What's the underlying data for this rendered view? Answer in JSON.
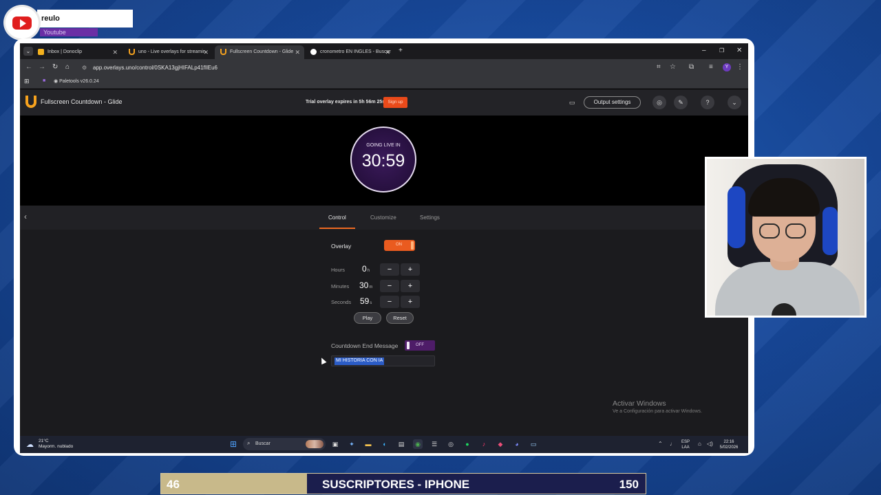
{
  "overlay_badge": {
    "channel_name": "reulo",
    "platform": "Youtube"
  },
  "browser": {
    "tabs": [
      {
        "label": "Inbox | Donoclip",
        "active": false
      },
      {
        "label": "uno - Live overlays for streamin",
        "active": false
      },
      {
        "label": "Fullscreen Countdown - Glide",
        "active": true
      },
      {
        "label": "cronometro EN INGLES - Buscar",
        "active": false
      }
    ],
    "url": "app.overlays.uno/control/0SKA13gjHIFALp41fIlEu6",
    "bookmark": "Paletools v26.0.24"
  },
  "app_header": {
    "title": "Fullscreen Countdown  -  Glide",
    "trial_text": "Trial overlay expires in 5h 56m 25s",
    "signup_label": "Sign up",
    "output_settings_label": "Output settings"
  },
  "preview": {
    "label": "GOING LIVE IN",
    "time": "30:59"
  },
  "control_tabs": [
    "Control",
    "Customize",
    "Settings"
  ],
  "controls": {
    "overlay_label": "Overlay",
    "overlay_state": "ON",
    "hours_label": "Hours",
    "hours_value": "0",
    "hours_unit": "h",
    "minutes_label": "Minutes",
    "minutes_value": "30",
    "minutes_unit": "m",
    "seconds_label": "Seconds",
    "seconds_value": "59",
    "seconds_unit": "s",
    "minus": "−",
    "plus": "+",
    "play_label": "Play",
    "reset_label": "Reset",
    "end_message_label": "Countdown End Message",
    "end_message_state": "OFF",
    "end_message_value": "MI HISTORIA CON IA"
  },
  "watermark": {
    "line1": "Activar Windows",
    "line2": "Ve a Configuración para activar Windows."
  },
  "taskbar": {
    "temperature": "21°C",
    "weather": "Mayorm. nublado",
    "search_placeholder": "Buscar",
    "lang_top": "ESP",
    "lang_bottom": "LAA",
    "time": "22:16",
    "date": "5/02/2026"
  },
  "bottom_bar": {
    "left_number": "46",
    "title": "SUSCRIPTORES - IPHONE",
    "right_number": "150"
  },
  "colors": {
    "accent_orange": "#ea5b1f",
    "toggle_off_purple": "#4e1c68",
    "background_blue": "#17489a"
  }
}
